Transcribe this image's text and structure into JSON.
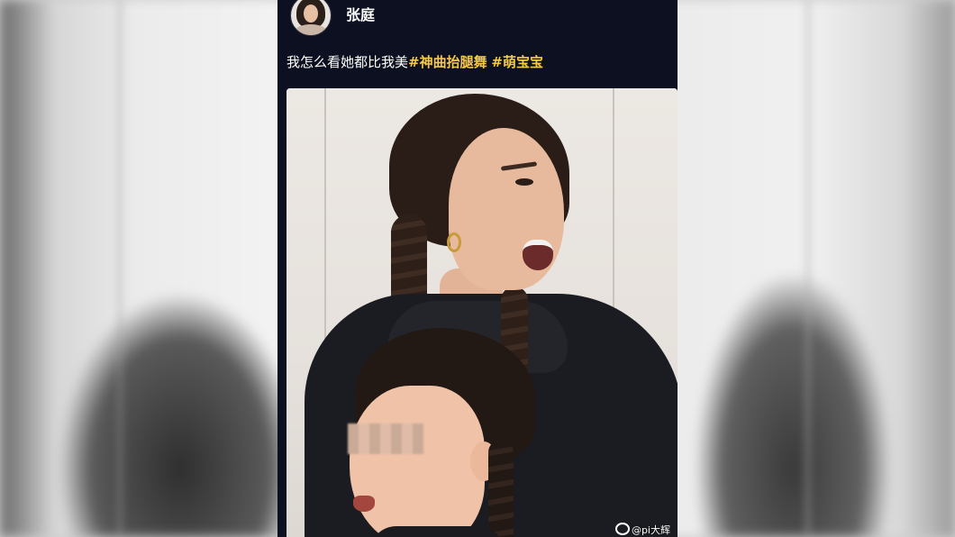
{
  "post": {
    "username": "张庭",
    "caption_text": "我怎么看她都比我美",
    "hashtags": [
      "#神曲抬腿舞",
      "#萌宝宝"
    ],
    "avatar_icon": "user-avatar-icon",
    "hashtag_color": "#f3c945",
    "background_color": "#0d1020"
  },
  "video": {
    "watermark": "@pi大辉",
    "watermark_icon": "weibo-logo-icon"
  }
}
